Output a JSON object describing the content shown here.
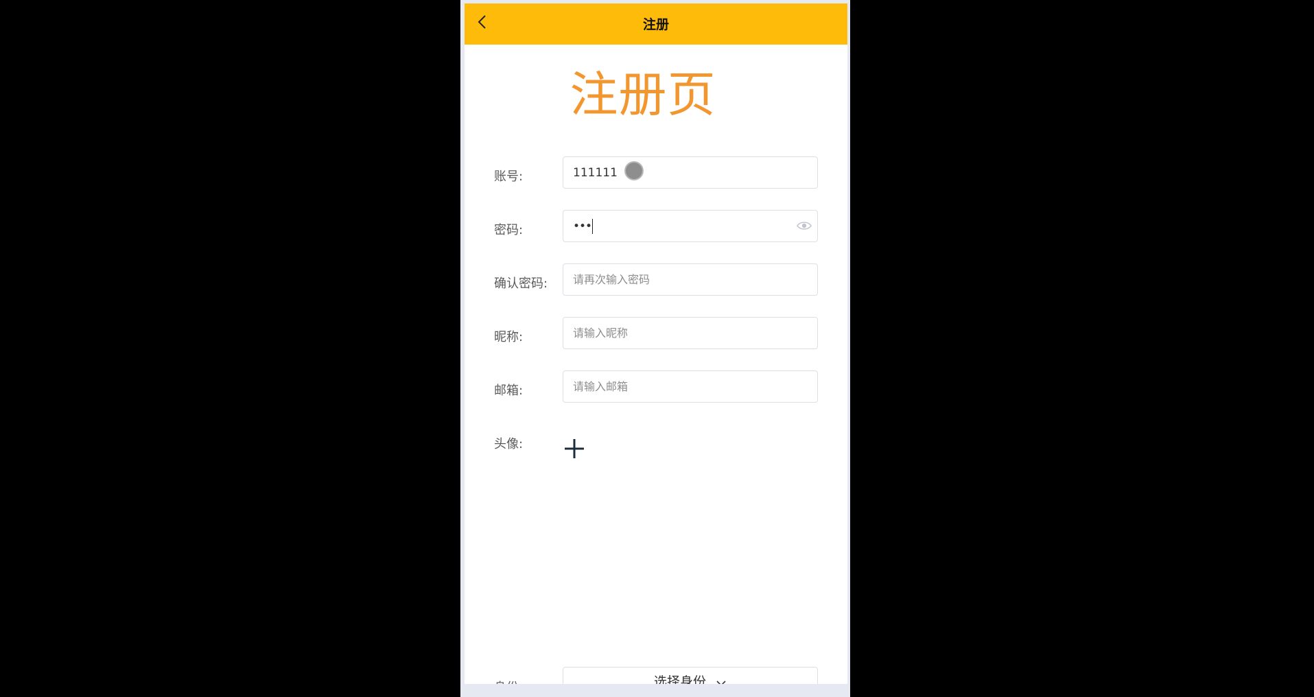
{
  "nav": {
    "title": "注册",
    "back_icon": "chevron-left-icon",
    "bg_color": "#ffbb09"
  },
  "heading": "注册页",
  "form": {
    "account": {
      "label": "账号:",
      "value": "111111"
    },
    "password": {
      "label": "密码:",
      "value": "•••",
      "toggle_icon": "eye-icon"
    },
    "confirm_password": {
      "label": "确认密码:",
      "placeholder": "请再次输入密码"
    },
    "nickname": {
      "label": "昵称:",
      "placeholder": "请输入昵称"
    },
    "email": {
      "label": "邮箱:",
      "placeholder": "请输入邮箱"
    },
    "avatar": {
      "label": "头像:",
      "upload_icon": "plus-icon"
    },
    "identity": {
      "label": "身份:",
      "button_text": "选择身份",
      "icon": "chevron-down-icon"
    }
  },
  "colors": {
    "heading": "#f29630",
    "label": "#5a5a5a",
    "placeholder": "#8d8d8d"
  }
}
